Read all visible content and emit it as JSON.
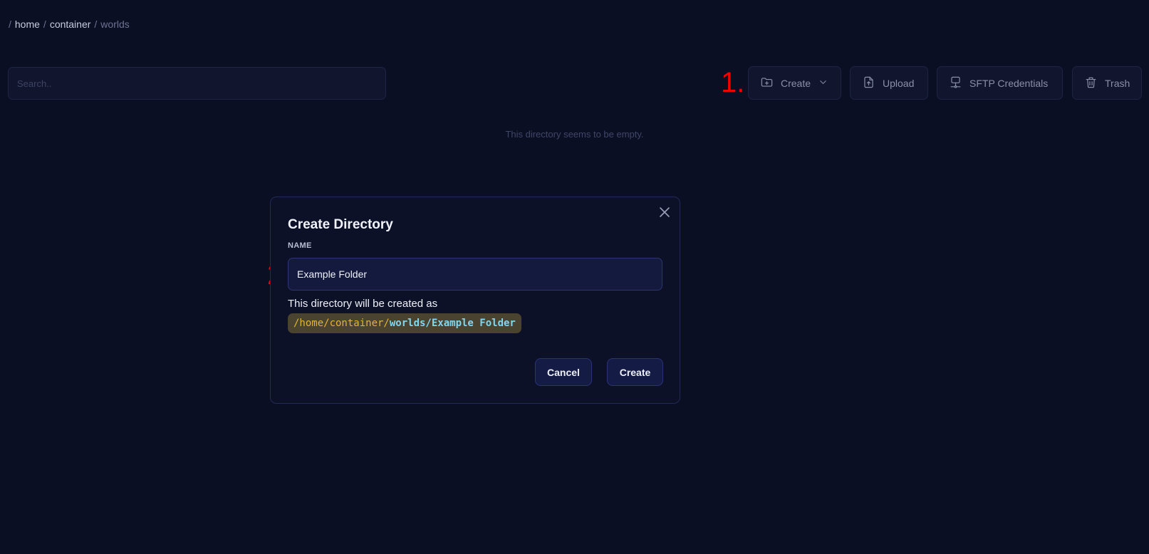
{
  "breadcrumb": {
    "separator": "/",
    "segments": [
      "home",
      "container",
      "worlds"
    ]
  },
  "search": {
    "placeholder": "Search.."
  },
  "toolbar": {
    "create_label": "Create",
    "upload_label": "Upload",
    "sftp_label": "SFTP Credentials",
    "trash_label": "Trash"
  },
  "empty_message": "This directory seems to be empty.",
  "annotations": [
    "1.",
    "2.",
    "3."
  ],
  "modal": {
    "title": "Create Directory",
    "name_label": "NAME",
    "name_value": "Example Folder",
    "hint": "This directory will be created as",
    "path_base": "/home/container/",
    "path_new": "worlds/Example Folder",
    "cancel_label": "Cancel",
    "confirm_label": "Create"
  },
  "colors": {
    "background": "#0b0f24",
    "annotation": "#f00000",
    "path_base": "#e2b33a",
    "path_new": "#7fd7ee"
  }
}
